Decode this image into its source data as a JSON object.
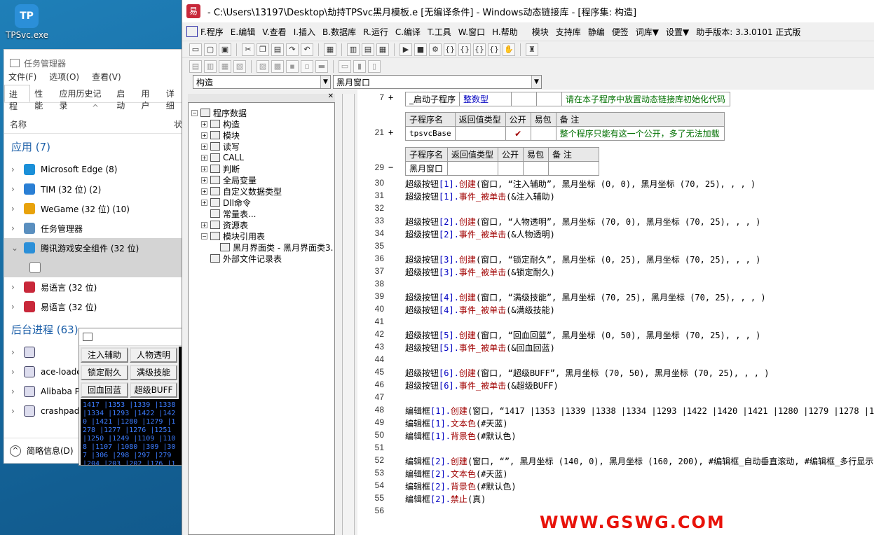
{
  "desktop": {
    "icon_label": "TPSvc.exe",
    "icon_text": "TP"
  },
  "task_manager": {
    "title": "任务管理器",
    "menu": [
      "文件(F)",
      "选项(O)",
      "查看(V)"
    ],
    "tabs": [
      "进程",
      "性能",
      "应用历史记录",
      "启动",
      "用户",
      "详细"
    ],
    "col_name": "名称",
    "col_status": "状",
    "apps_header": "应用 (7)",
    "apps": [
      {
        "label": "Microsoft Edge (8)",
        "color": "#1a8fd8"
      },
      {
        "label": "TIM (32 位) (2)",
        "color": "#2a7fd4"
      },
      {
        "label": "WeGame (32 位) (10)",
        "color": "#e8a20c"
      },
      {
        "label": "任务管理器",
        "color": "#5a8fbf"
      },
      {
        "label": "腾讯游戏安全组件 (32 位)",
        "color": "#2b8fd8"
      },
      {
        "label": "易语言 (32 位)",
        "color": "#c8283a"
      },
      {
        "label": "易语言 (32 位)",
        "color": "#c8283a"
      }
    ],
    "bg_header": "后台进程 (63)",
    "bg_items": [
      {
        "label": ""
      },
      {
        "label": "ace-loade"
      },
      {
        "label": "Alibaba P"
      },
      {
        "label": "crashpad"
      }
    ],
    "bottom_label": "简略信息(D)"
  },
  "small_app": {
    "buttons": [
      "注入辅助",
      "人物透明",
      "锁定耐久",
      "满级技能",
      "回血回蓝",
      "超级BUFF"
    ],
    "edit_text": "1417 |1353 |1339 |1338 |1334 |1293 |1422 |1420 |1421 |1280 |1279 |1278 |1277 |1276 |1251 |1250 |1249 |1109 |1108 |1107 |1080 |309 |307 |306 |298 |297 |279 |204 |203 |202 |176 |175 |165 |55"
  },
  "ide": {
    "title": "- C:\\Users\\13197\\Desktop\\劫持TPSvc黑月模板.e [无编译条件] - Windows动态链接库 - [程序集: 构造]",
    "menu": [
      "F.程序",
      "E.编辑",
      "V.查看",
      "I.插入",
      "B.数据库",
      "R.运行",
      "C.编译",
      "T.工具",
      "W.窗口",
      "H.帮助",
      "模块",
      "支持库",
      "静编",
      "便签",
      "词库▼",
      "设置▼",
      "助手版本: 3.3.0101 正式版"
    ],
    "combo_left": "构造",
    "combo_right": "黑月窗口",
    "tree": [
      {
        "label": "程序数据",
        "pm": "−",
        "indent": 0
      },
      {
        "label": "构造",
        "pm": "+",
        "indent": 1
      },
      {
        "label": "模块",
        "pm": "+",
        "indent": 1
      },
      {
        "label": "读写",
        "pm": "+",
        "indent": 1
      },
      {
        "label": "CALL",
        "pm": "+",
        "indent": 1
      },
      {
        "label": "判断",
        "pm": "+",
        "indent": 1
      },
      {
        "label": "全局变量",
        "pm": "+",
        "indent": 1
      },
      {
        "label": "自定义数据类型",
        "pm": "+",
        "indent": 1
      },
      {
        "label": "Dll命令",
        "pm": "+",
        "indent": 1
      },
      {
        "label": "常量表...",
        "pm": "",
        "indent": 1
      },
      {
        "label": "资源表",
        "pm": "+",
        "indent": 1
      },
      {
        "label": "模块引用表",
        "pm": "−",
        "indent": 1
      },
      {
        "label": "黑月界面类 - 黑月界面类3.",
        "pm": "",
        "indent": 2
      },
      {
        "label": "外部文件记录表",
        "pm": "",
        "indent": 1
      }
    ],
    "table1": {
      "num": "7",
      "sign": "+",
      "cells": [
        "_启动子程序",
        "整数型",
        "",
        "",
        "请在本子程序中放置动态链接库初始化代码"
      ]
    },
    "table2": {
      "headers": [
        "子程序名",
        "返回值类型",
        "公开",
        "易包",
        "备 注"
      ],
      "num": "21",
      "sign": "+",
      "cells": [
        "tpsvcBase",
        "",
        "✔",
        "",
        "整个程序只能有这一个公开，多了无法加载"
      ]
    },
    "table3": {
      "headers": [
        "子程序名",
        "返回值类型",
        "公开",
        "易包",
        "备 注"
      ],
      "num": "29",
      "sign": "−",
      "cells": [
        "黑月窗口",
        "",
        "",
        "",
        ""
      ]
    },
    "lines": [
      {
        "n": "30",
        "obj": "超级按钮",
        "idx": "[1].",
        "m": "创建",
        "args": "(窗口, “注入辅助”, 黑月坐标 (0, 0), 黑月坐标 (70, 25), , , )"
      },
      {
        "n": "31",
        "obj": "超级按钮",
        "idx": "[1].",
        "m": "事件_被单击",
        "args": "(&注入辅助)"
      },
      {
        "n": "32",
        "obj": "",
        "idx": "",
        "m": "",
        "args": ""
      },
      {
        "n": "33",
        "obj": "超级按钮",
        "idx": "[2].",
        "m": "创建",
        "args": "(窗口, “人物透明”, 黑月坐标 (70, 0), 黑月坐标 (70, 25), , , )"
      },
      {
        "n": "34",
        "obj": "超级按钮",
        "idx": "[2].",
        "m": "事件_被单击",
        "args": "(&人物透明)"
      },
      {
        "n": "35",
        "obj": "",
        "idx": "",
        "m": "",
        "args": ""
      },
      {
        "n": "36",
        "obj": "超级按钮",
        "idx": "[3].",
        "m": "创建",
        "args": "(窗口, “锁定耐久”, 黑月坐标 (0, 25), 黑月坐标 (70, 25), , , )"
      },
      {
        "n": "37",
        "obj": "超级按钮",
        "idx": "[3].",
        "m": "事件_被单击",
        "args": "(&锁定耐久)"
      },
      {
        "n": "38",
        "obj": "",
        "idx": "",
        "m": "",
        "args": ""
      },
      {
        "n": "39",
        "obj": "超级按钮",
        "idx": "[4].",
        "m": "创建",
        "args": "(窗口, “满级技能”, 黑月坐标 (70, 25), 黑月坐标 (70, 25), , , )"
      },
      {
        "n": "40",
        "obj": "超级按钮",
        "idx": "[4].",
        "m": "事件_被单击",
        "args": "(&满级技能)"
      },
      {
        "n": "41",
        "obj": "",
        "idx": "",
        "m": "",
        "args": ""
      },
      {
        "n": "42",
        "obj": "超级按钮",
        "idx": "[5].",
        "m": "创建",
        "args": "(窗口, “回血回蓝”, 黑月坐标 (0, 50), 黑月坐标 (70, 25), , , )"
      },
      {
        "n": "43",
        "obj": "超级按钮",
        "idx": "[5].",
        "m": "事件_被单击",
        "args": "(&回血回蓝)"
      },
      {
        "n": "44",
        "obj": "",
        "idx": "",
        "m": "",
        "args": ""
      },
      {
        "n": "45",
        "obj": "超级按钮",
        "idx": "[6].",
        "m": "创建",
        "args": "(窗口, “超级BUFF”, 黑月坐标 (70, 50), 黑月坐标 (70, 25), , , )"
      },
      {
        "n": "46",
        "obj": "超级按钮",
        "idx": "[6].",
        "m": "事件_被单击",
        "args": "(&超级BUFF)"
      },
      {
        "n": "47",
        "obj": "",
        "idx": "",
        "m": "",
        "args": ""
      },
      {
        "n": "48",
        "obj": "编辑框",
        "idx": "[1].",
        "m": "创建",
        "args": "(窗口, “1417 |1353 |1339 |1338 |1334 |1293 |1422 |1420 |1421 |1280 |1279 |1278 |1277 |1276 |1251 |1250 |1249 |11"
      },
      {
        "n": "49",
        "obj": "编辑框",
        "idx": "[1].",
        "m": "文本色",
        "args": "(#天蓝)"
      },
      {
        "n": "50",
        "obj": "编辑框",
        "idx": "[1].",
        "m": "背景色",
        "args": "(#默认色)"
      },
      {
        "n": "51",
        "obj": "",
        "idx": "",
        "m": "",
        "args": ""
      },
      {
        "n": "52",
        "obj": "编辑框",
        "idx": "[2].",
        "m": "创建",
        "args": "(窗口, “”, 黑月坐标 (140, 0), 黑月坐标 (160, 200), #编辑框_自动垂直滚动, #编辑框_多行显示)"
      },
      {
        "n": "53",
        "obj": "编辑框",
        "idx": "[2].",
        "m": "文本色",
        "args": "(#天蓝)"
      },
      {
        "n": "54",
        "obj": "编辑框",
        "idx": "[2].",
        "m": "背景色",
        "args": "(#默认色)"
      },
      {
        "n": "55",
        "obj": "编辑框",
        "idx": "[2].",
        "m": "禁止",
        "args": "(真)"
      },
      {
        "n": "56",
        "obj": "",
        "idx": "",
        "m": "",
        "args": ""
      }
    ],
    "watermark": "WWW.GSWG.COM"
  }
}
